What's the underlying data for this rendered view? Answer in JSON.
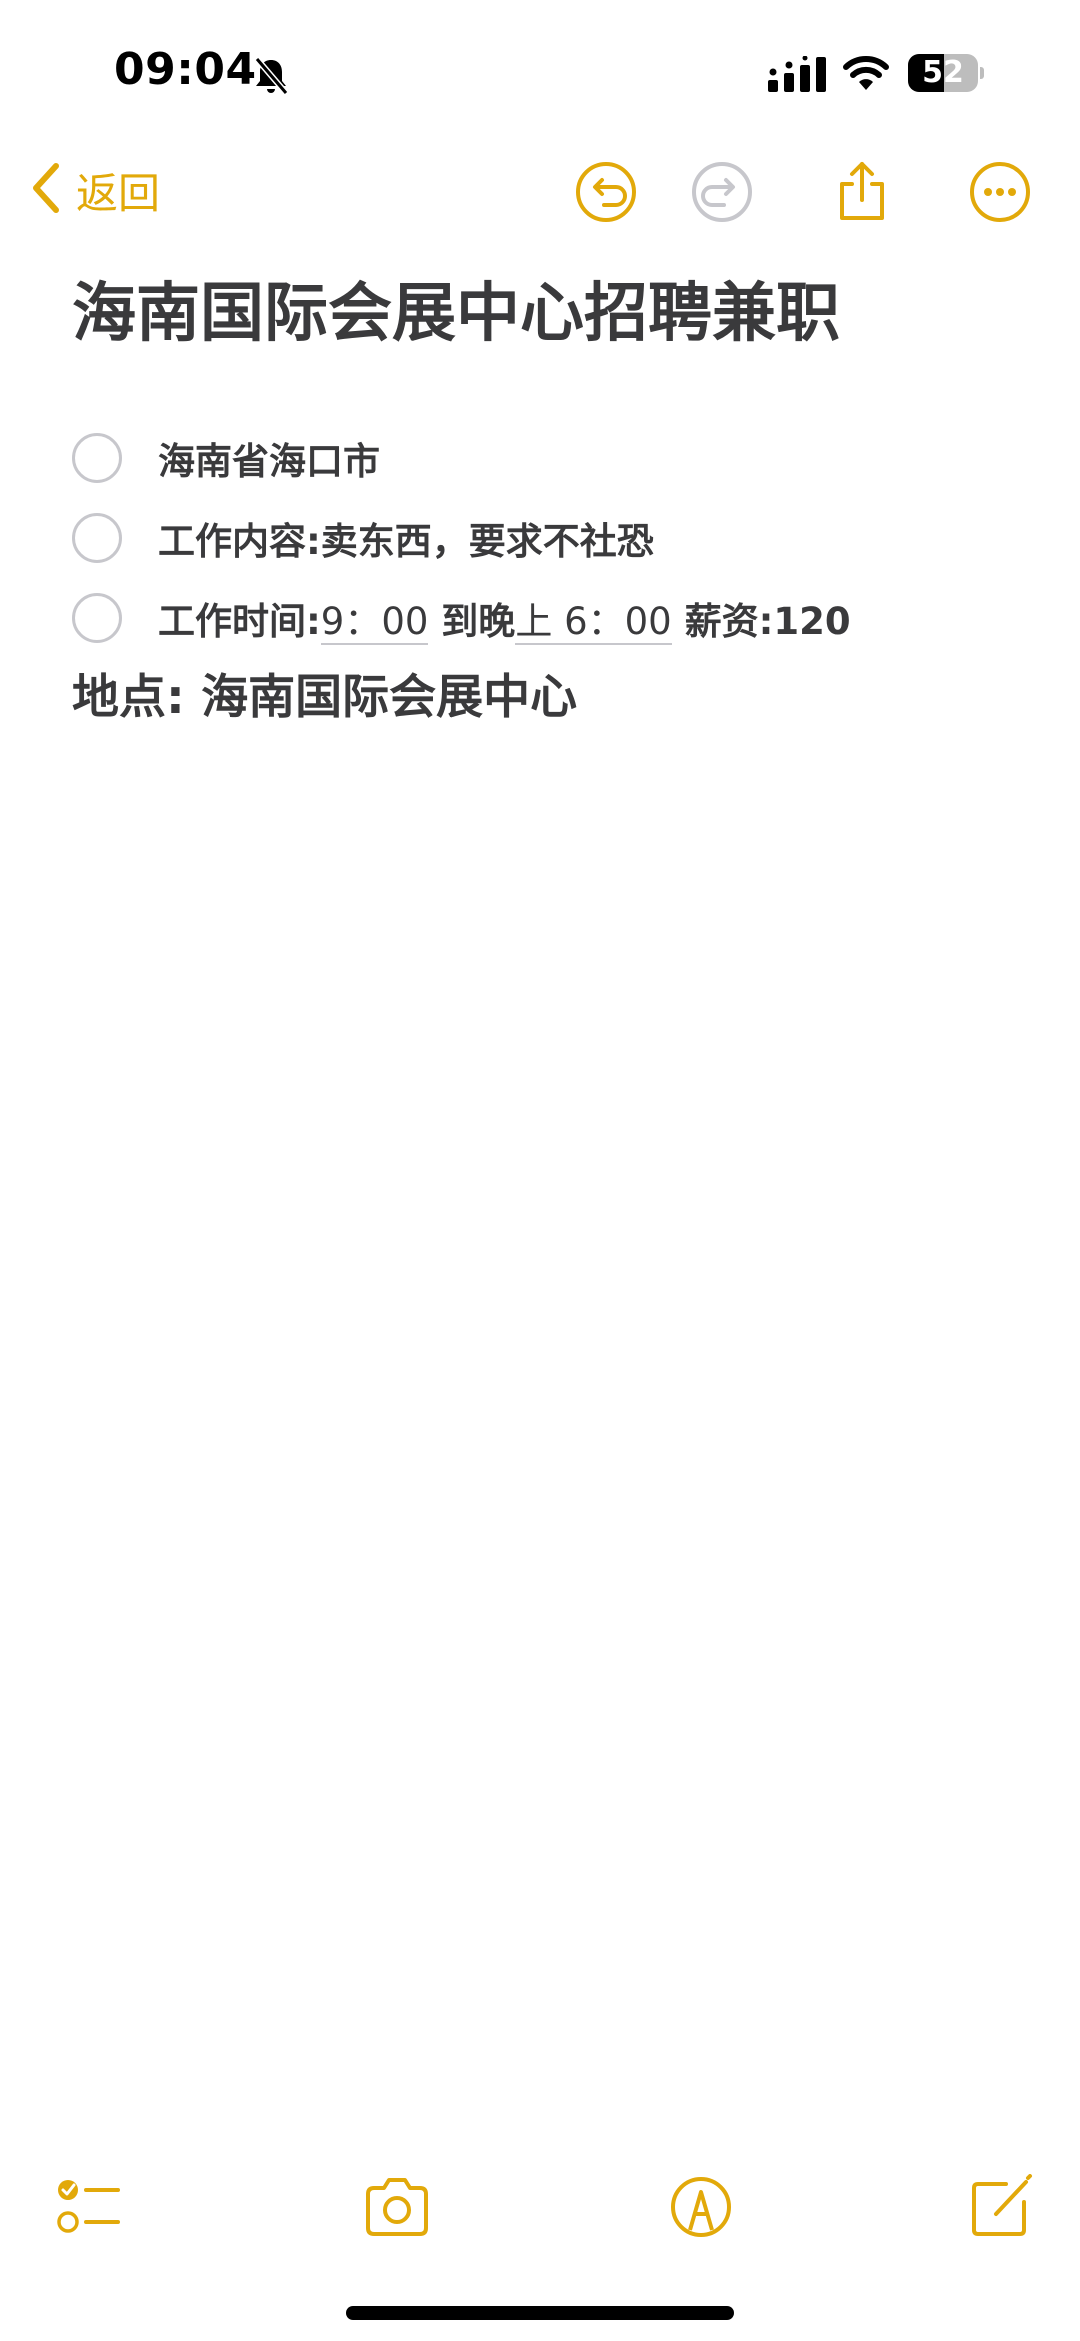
{
  "status_bar": {
    "time": "09:04",
    "battery_text": "52",
    "battery_level": 0.52,
    "icons": [
      "bell-slash-icon",
      "cellular-signal-icon",
      "wifi-icon",
      "battery-icon"
    ]
  },
  "nav": {
    "back_label": "返回",
    "icons": [
      "chevron-left-icon",
      "undo-icon",
      "redo-icon",
      "share-icon",
      "more-icon"
    ]
  },
  "note": {
    "title": "海南国际会展中心招聘兼职",
    "checklist": [
      {
        "text": "海南省海口市",
        "checked": false
      },
      {
        "text": "工作内容:卖东西，要求不社恐",
        "checked": false
      },
      {
        "text_prefix": "工作时间:",
        "start_time": "9：00",
        "mid_text": " 到晚",
        "end_time": "上 6：00",
        "suffix": " 薪资:120",
        "checked": false
      }
    ],
    "location": "地点: 海南国际会展中心"
  },
  "toolbar": {
    "icons": [
      "checklist-icon",
      "camera-icon",
      "markup-pen-icon",
      "compose-icon"
    ]
  },
  "colors": {
    "accent": "#e2a90a",
    "text": "#3a3a3c",
    "disabled": "#c7c7cc"
  }
}
